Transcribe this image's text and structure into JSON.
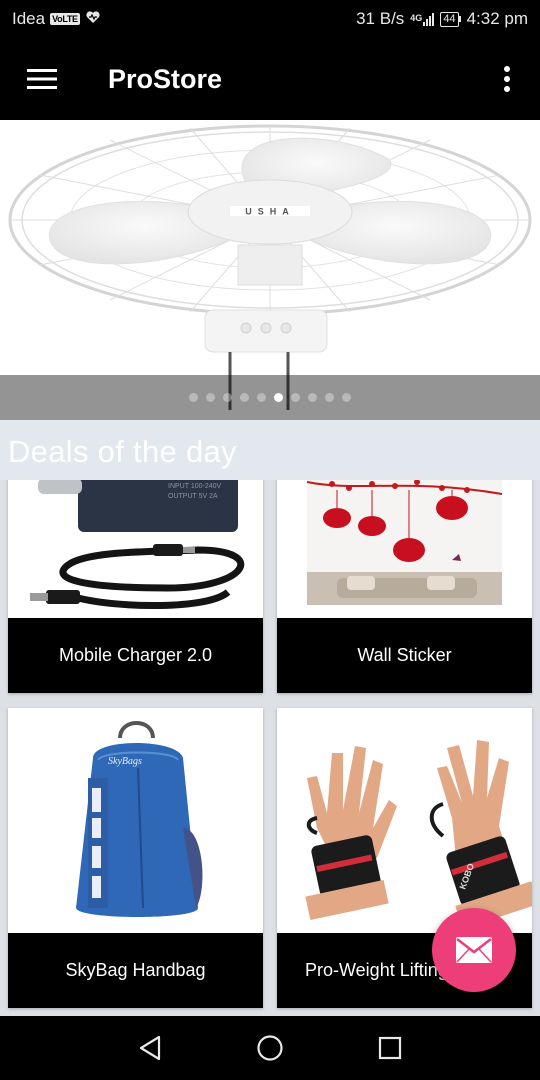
{
  "status_bar": {
    "carrier": "Idea",
    "volte": "VoLTE",
    "speed": "31 B/s",
    "network": "4G",
    "battery": "44",
    "time": "4:32 pm"
  },
  "app_bar": {
    "title": "ProStore",
    "menu_icon": "hamburger-menu-icon",
    "overflow_icon": "more-vert-icon"
  },
  "banner": {
    "fan_brand": "USHA",
    "page_count": 10,
    "active_page": 5
  },
  "deals": {
    "title": "Deals of the day",
    "products": [
      {
        "name": "Mobile Charger 2.0"
      },
      {
        "name": "Wall Sticker"
      },
      {
        "name": "SkyBag Handbag"
      },
      {
        "name": "Pro-Weight Lifting"
      }
    ]
  },
  "fab": {
    "icon": "mail-icon",
    "color": "#ee3e7a"
  },
  "nav_bar": {
    "back_icon": "back-icon",
    "home_icon": "home-icon",
    "recents_icon": "recents-icon"
  }
}
